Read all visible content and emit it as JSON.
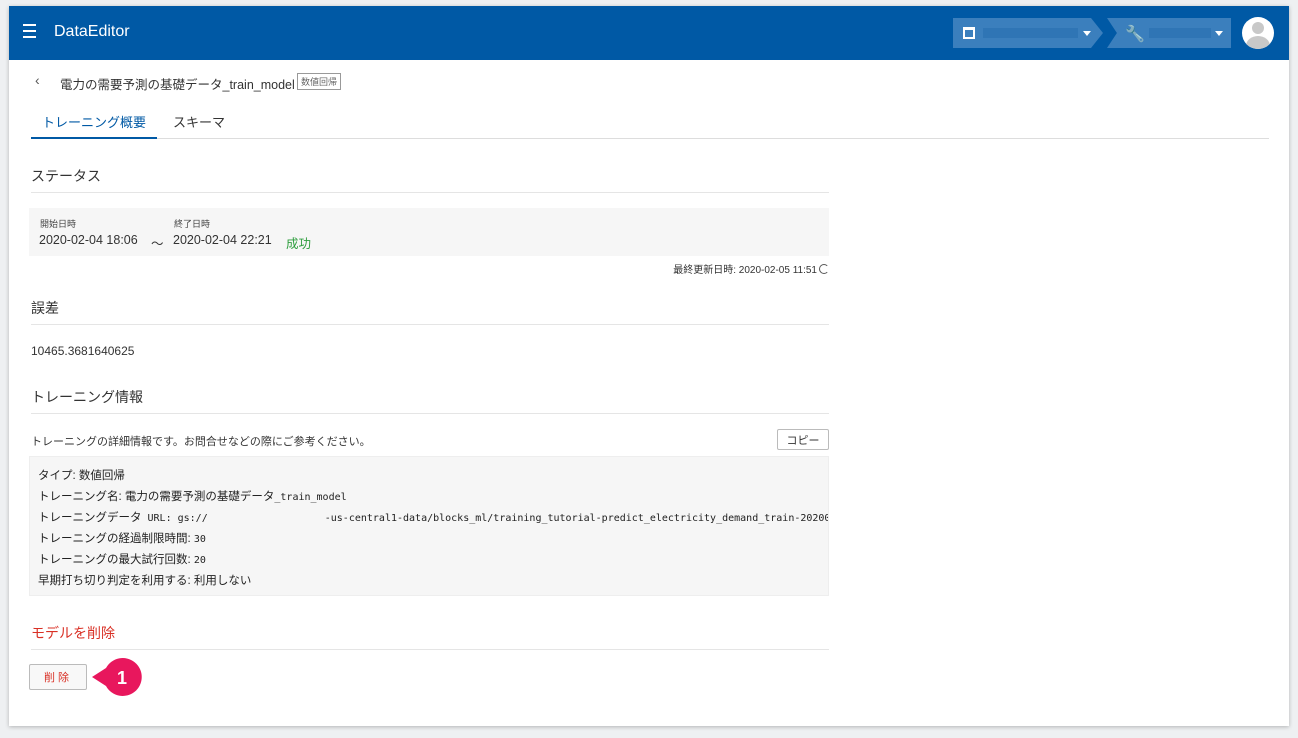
{
  "app": {
    "title": "DataEditor"
  },
  "page": {
    "model_name": "電力の需要予測の基礎データ_train_model",
    "model_type_badge": "数値回帰",
    "tabs": [
      {
        "label": "トレーニング概要",
        "active": true
      },
      {
        "label": "スキーマ",
        "active": false
      }
    ]
  },
  "status": {
    "heading": "ステータス",
    "start_label": "開始日時",
    "start_value": "2020-02-04 18:06",
    "separator": "〜",
    "end_label": "終了日時",
    "end_value": "2020-02-04 22:21",
    "result": "成功",
    "last_updated": "最終更新日時: 2020-02-05 11:51"
  },
  "error": {
    "heading": "誤差",
    "value": "10465.3681640625"
  },
  "training_info": {
    "heading": "トレーニング情報",
    "description": "トレーニングの詳細情報です。お問合せなどの際にご参考ください。",
    "copy_label": "コピー",
    "lines": {
      "type": "タイプ: 数値回帰",
      "name_prefix": "トレーニング名: 電力の需要予測の基礎データ",
      "name_suffix": "_train_model",
      "data_prefix": "トレーニングデータ",
      "data_url_start": " URL: gs://",
      "data_url_end": "-us-central1-data/blocks_ml/training_tutorial-predict_electricity_demand_train-20200",
      "time_limit_label": "トレーニングの経過制限時間: ",
      "time_limit_value": "30",
      "max_trials_label": "トレーニングの最大試行回数: ",
      "max_trials_value": "20",
      "early_stop": "早期打ち切り判定を利用する: 利用しない"
    }
  },
  "delete": {
    "heading": "モデルを削除",
    "button_label": "削除"
  },
  "callout": {
    "number": "1",
    "color": "#e8175d"
  },
  "colors": {
    "appbar": "#0059a5",
    "success": "#2e9e3e",
    "danger": "#d93025"
  }
}
